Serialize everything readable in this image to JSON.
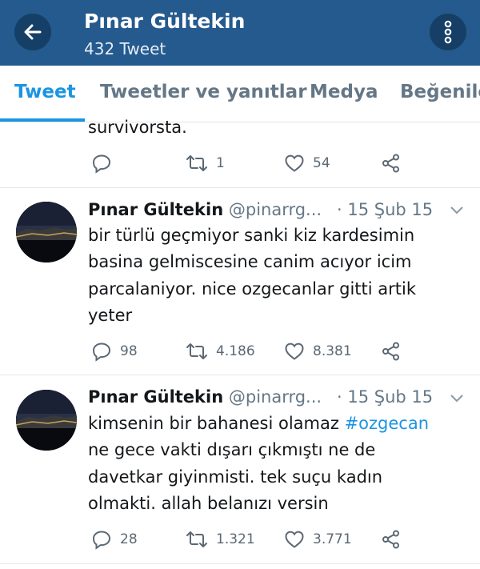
{
  "header": {
    "profile_name": "Pınar Gültekin",
    "tweet_count": "432 Tweet",
    "back_icon": "arrow-left-icon",
    "overflow_icon": "more-vertical-icon"
  },
  "tabs": [
    {
      "label": "Tweet",
      "active": true
    },
    {
      "label": "Tweetler ve yanıtlar",
      "active": false
    },
    {
      "label": "Medya",
      "active": false
    },
    {
      "label": "Beğenile",
      "active": false
    }
  ],
  "tweets": [
    {
      "partial_text_tail": "survivorsta.",
      "replies": "",
      "retweets": "1",
      "likes": "54"
    },
    {
      "name": "Pınar Gültekin",
      "handle": "@pinarrg...",
      "time": "· 15 Şub 15",
      "lines": [
        "bir türlü geçmiyor sanki kiz kardesimin",
        "basina gelmiscesine canim acıyor icim",
        "parcalaniyor. nice ozgecanlar gitti artik",
        "yeter"
      ],
      "replies": "98",
      "retweets": "4.186",
      "likes": "8.381"
    },
    {
      "name": "Pınar Gültekin",
      "handle": "@pinarrg...",
      "time": "· 15 Şub 15",
      "line1_text": "kimsenin bir bahanesi olamaz ",
      "line1_hashtag": "#ozgecan",
      "lines": [
        "ne gece vakti dışarı çıkmıştı ne de",
        "davetkar giyinmisti. tek suçu kadın",
        "olmakti. allah belanızı versin"
      ],
      "replies": "28",
      "retweets": "1.321",
      "likes": "3.771"
    }
  ],
  "colors": {
    "header_bg": "#245a8e",
    "accent": "#1b95e0",
    "secondary_text": "#657786"
  }
}
